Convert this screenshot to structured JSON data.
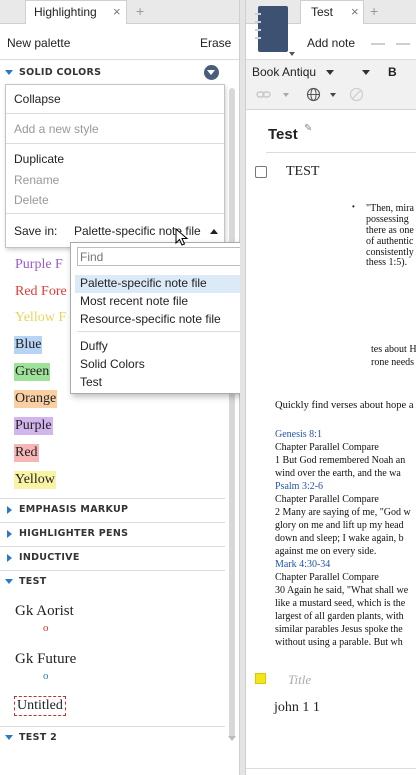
{
  "left": {
    "tab": {
      "title": "Highlighting"
    },
    "toolbar": {
      "new_palette": "New palette",
      "erase": "Erase"
    },
    "solid_colors_header": "SOLID COLORS",
    "menu": {
      "collapse": "Collapse",
      "add_style_placeholder": "Add a new style",
      "duplicate": "Duplicate",
      "rename": "Rename",
      "delete": "Delete",
      "save_in_label": "Save in:",
      "save_in_value": "Palette-specific note file"
    },
    "styles": {
      "partial_purple": "Purple F",
      "partial_red": "Red Fore",
      "partial_yellow": "Yellow F",
      "blue": "Blue",
      "green": "Green",
      "orange": "Orange",
      "purple": "Purple",
      "red": "Red",
      "yellow": "Yellow"
    },
    "sections": [
      "EMPHASIS MARKUP",
      "HIGHLIGHTER PENS",
      "INDUCTIVE",
      "TEST"
    ],
    "test_styles": {
      "gk_aorist": "Gk Aorist",
      "gk_aorist_mark": "o",
      "gk_future": "Gk Future",
      "gk_future_mark": "o",
      "untitled": "Untitled"
    },
    "test2_header": "TEST 2",
    "dropdown": {
      "find_placeholder": "Find",
      "group1": [
        "Palette-specific note file",
        "Most recent note file",
        "Resource-specific note file"
      ],
      "group2": [
        "Duffy",
        "Solid Colors",
        "Test"
      ]
    }
  },
  "right": {
    "tab": {
      "title": "Test"
    },
    "toolbar": {
      "add_note": "Add note",
      "font_name": "Book Antiqu",
      "bold": "B"
    },
    "doc_title": "Test",
    "note_title": "TEST",
    "bullet_lines": [
      "\"Then, mira",
      "possessing",
      "there as one",
      "of authentic",
      "consistently",
      "thess 1:5)."
    ],
    "lines_a": [
      "tes about H",
      "rone needs"
    ],
    "quick_find": "Quickly find verses about hope a",
    "passages": [
      {
        "ref": "Genesis 8:1",
        "links": "Chapter  Parallel  Compare",
        "text": [
          "1 But God remembered Noah an",
          "wind over the earth, and the wa"
        ]
      },
      {
        "ref": "Psalm 3:2-6",
        "links": "Chapter  Parallel  Compare",
        "text": [
          "2 Many are saying of me, \"God w",
          "glory on me and lift up my head",
          "down and sleep; I wake again, b",
          "against me on every side."
        ]
      },
      {
        "ref": "Mark 4:30-34",
        "links": "Chapter  Parallel  Compare",
        "text": [
          "30 Again he said, \"What shall we",
          "like a mustard seed, which is the",
          "largest of all garden plants, with",
          "similar parables Jesus spoke the",
          "without using a parable. But wh"
        ]
      }
    ],
    "title_placeholder": "Title",
    "john": "john 1 1"
  },
  "colors": {
    "accent": "#2a78c8",
    "blue_hl": "#b8d4f5",
    "green_hl": "#9ee29a",
    "orange_hl": "#f9cfa3",
    "purple_hl": "#d2b5ec",
    "red_hl": "#f6b6b6",
    "yellow_hl": "#f9f3a5",
    "selected_option": "#dce9f7"
  }
}
